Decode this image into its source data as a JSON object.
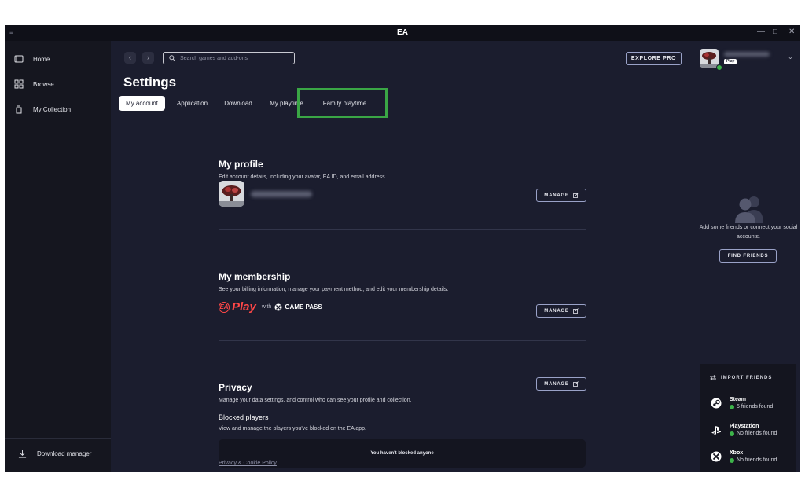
{
  "window": {
    "title": "EA"
  },
  "sidebar": {
    "items": [
      {
        "label": "Home",
        "icon": "home-icon"
      },
      {
        "label": "Browse",
        "icon": "grid-icon"
      },
      {
        "label": "My Collection",
        "icon": "collection-icon"
      }
    ],
    "download_manager": "Download manager"
  },
  "topbar": {
    "search_placeholder": "Search games and add-ons",
    "explore_button": "EXPLORE PRO"
  },
  "settings": {
    "title": "Settings",
    "tabs": [
      "My account",
      "Application",
      "Download",
      "My playtime",
      "Family playtime"
    ],
    "active_tab": "My account",
    "highlighted_tab": "Family playtime",
    "highlight_color": "#3aa645"
  },
  "profile": {
    "title": "My profile",
    "description": "Edit account details, including your avatar, EA ID, and email address.",
    "manage": "MANAGE"
  },
  "membership": {
    "title": "My membership",
    "description": "See your billing information, manage your payment method, and edit your membership details.",
    "logo_ea": "EA",
    "logo_play": "Play",
    "logo_with": "with",
    "logo_gamepass": "GAME PASS",
    "manage": "MANAGE",
    "brand_color": "#ff4747"
  },
  "privacy": {
    "title": "Privacy",
    "description": "Manage your data settings, and control who can see your profile and collection.",
    "manage": "MANAGE",
    "blocked_title": "Blocked players",
    "blocked_description": "View and manage the players you've blocked on the EA app.",
    "blocked_empty": "You haven't blocked anyone",
    "policy_link": "Privacy & Cookie Policy"
  },
  "friends_panel": {
    "user_badge": "Play",
    "empty_text": "Add some friends or connect your social accounts.",
    "find_friends": "FIND FRIENDS",
    "import_title": "IMPORT FRIENDS",
    "import_sources": [
      {
        "name": "Steam",
        "status": "5 friends found",
        "icon": "steam-icon"
      },
      {
        "name": "Playstation",
        "status": "No friends found",
        "icon": "playstation-icon"
      },
      {
        "name": "Xbox",
        "status": "No friends found",
        "icon": "xbox-icon"
      }
    ],
    "status_color": "#3db34a"
  }
}
